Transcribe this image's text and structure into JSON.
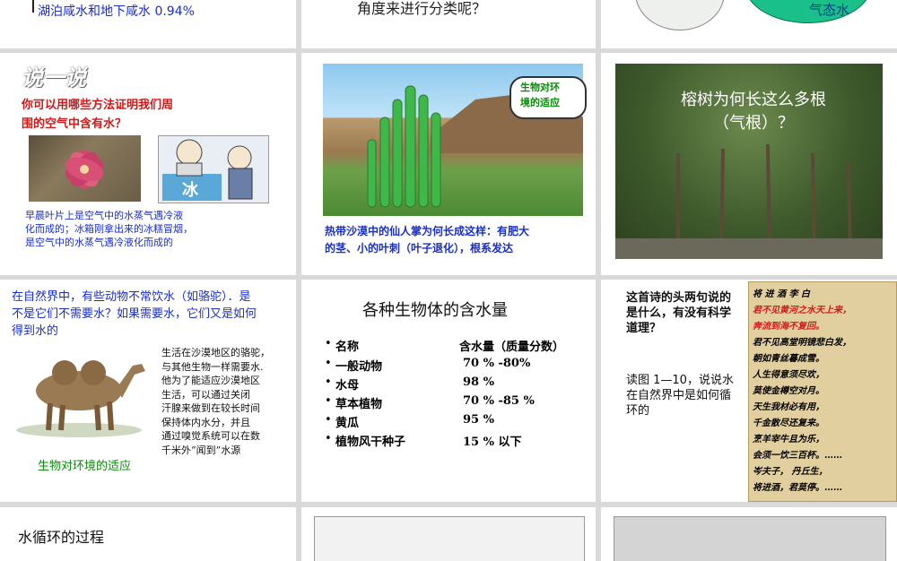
{
  "slides": {
    "s1": {
      "text": "湖泊咸水和地下咸水  0.94%"
    },
    "s2": {
      "text": "角度来进行分类呢？"
    },
    "s3": {
      "label": "气态水"
    },
    "s4": {
      "badge": "说一说",
      "title": "你可以用哪些方法证明我们周\n围的空气中含有水？",
      "ice_label": "冰",
      "body": "早晨叶片上是空气中的水蒸气遇冷液\n化而成的；冰箱刚拿出来的冰糕冒烟，\n是空气中的水蒸气遇冷液化而成的"
    },
    "s5": {
      "bubble": "生物对环\n境的适应",
      "caption": "热带沙漠中的仙人掌为何长成这样：有肥大\n的茎、小的叶刺（叶子退化），根系发达"
    },
    "s6": {
      "title": "榕树为何长这么多根\n（气根）？"
    },
    "s7": {
      "question": "在自然界中，有些动物不常饮水（如骆驼）．是\n不是它们不需要水？如果需要水，它们又是如何\n得到水的",
      "body": "生活在沙漠地区的骆驼，\n与其他生物一样需要水.\n他为了能适应沙漠地区\n生活，可以通过关闭\n汗腺来做到在较长时间\n保持体内水分，并且\n通过嗅觉系统可以在数\n千米外“闻到”水源",
      "footer": "生物对环境的适应"
    },
    "s8": {
      "title": "各种生物体的含水量",
      "header_name": "名称",
      "header_value": "含水量（质量分数）",
      "rows": [
        {
          "name": "一般动物",
          "value": "70 % -80%"
        },
        {
          "name": "水母",
          "value": "98 %"
        },
        {
          "name": "草本植物",
          "value": "70 % -85 %"
        },
        {
          "name": "黄瓜",
          "value": "95 %"
        },
        {
          "name": "植物风干种子",
          "value": "15 % 以下"
        }
      ]
    },
    "s9": {
      "question": "这首诗的头两句说的\n是什么，有没有科学\n道理？",
      "body": "读图 1—10，说说水\n在自然界中是如何循\n环的",
      "poem_lines": [
        "将 进 酒      李 白",
        "君不见黄河之水天上来，",
        "奔流到海不复回。",
        "君不见高堂明镜悲白发，",
        "朝如青丝暮成雪。",
        "人生得意须尽欢，",
        "莫使金樽空对月。",
        "天生我材必有用，",
        "千金散尽还复来。",
        "烹羊宰牛且为乐，",
        "会须一饮三百杯。……",
        "岑夫子， 丹丘生，",
        "将进酒，君莫停。……"
      ]
    },
    "s10": {
      "title": "水循环的过程"
    }
  }
}
